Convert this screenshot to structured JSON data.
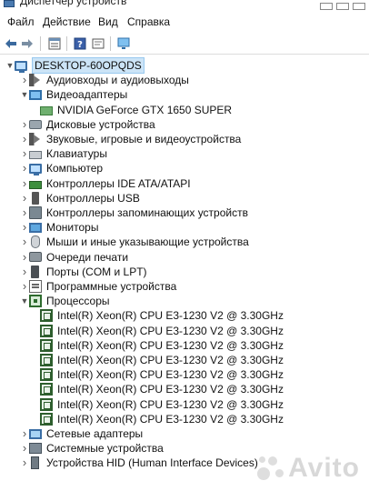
{
  "window": {
    "title": "Диспетчер устройств"
  },
  "menu": [
    "Файл",
    "Действие",
    "Вид",
    "Справка"
  ],
  "toolbar": [
    {
      "icon": "back-arrow-icon"
    },
    {
      "icon": "forward-arrow-icon"
    },
    {
      "icon": "properties-icon"
    },
    {
      "icon": "help-icon"
    },
    {
      "icon": "scan-hardware-icon"
    },
    {
      "icon": "monitor-view-icon"
    }
  ],
  "tree": {
    "root": "DESKTOP-60OPQDS",
    "items": [
      {
        "label": "Аудиовходы и аудиовыходы",
        "icon": "speaker-icon",
        "expanded": false
      },
      {
        "label": "Видеоадаптеры",
        "icon": "display-adapter-icon",
        "expanded": true
      },
      {
        "label": "NVIDIA GeForce GTX 1650 SUPER",
        "icon": "gpu-icon",
        "child": true
      },
      {
        "label": "Дисковые устройства",
        "icon": "disk-icon",
        "expanded": false
      },
      {
        "label": "Звуковые, игровые и видеоустройства",
        "icon": "sound-device-icon",
        "expanded": false
      },
      {
        "label": "Клавиатуры",
        "icon": "keyboard-icon",
        "expanded": false
      },
      {
        "label": "Компьютер",
        "icon": "computer-icon",
        "expanded": false
      },
      {
        "label": "Контроллеры IDE ATA/ATAPI",
        "icon": "ide-controller-icon",
        "expanded": false
      },
      {
        "label": "Контроллеры USB",
        "icon": "usb-icon",
        "expanded": false
      },
      {
        "label": "Контроллеры запоминающих устройств",
        "icon": "storage-controller-icon",
        "expanded": false
      },
      {
        "label": "Мониторы",
        "icon": "monitor-icon",
        "expanded": false
      },
      {
        "label": "Мыши и иные указывающие устройства",
        "icon": "mouse-icon",
        "expanded": false
      },
      {
        "label": "Очереди печати",
        "icon": "printer-icon",
        "expanded": false
      },
      {
        "label": "Порты (COM и LPT)",
        "icon": "port-icon",
        "expanded": false
      },
      {
        "label": "Программные устройства",
        "icon": "software-device-icon",
        "expanded": false
      },
      {
        "label": "Процессоры",
        "icon": "processor-icon",
        "expanded": true
      },
      {
        "label": "Intel(R) Xeon(R) CPU E3-1230 V2 @ 3.30GHz",
        "icon": "cpu-icon",
        "child": true
      },
      {
        "label": "Intel(R) Xeon(R) CPU E3-1230 V2 @ 3.30GHz",
        "icon": "cpu-icon",
        "child": true
      },
      {
        "label": "Intel(R) Xeon(R) CPU E3-1230 V2 @ 3.30GHz",
        "icon": "cpu-icon",
        "child": true
      },
      {
        "label": "Intel(R) Xeon(R) CPU E3-1230 V2 @ 3.30GHz",
        "icon": "cpu-icon",
        "child": true
      },
      {
        "label": "Intel(R) Xeon(R) CPU E3-1230 V2 @ 3.30GHz",
        "icon": "cpu-icon",
        "child": true
      },
      {
        "label": "Intel(R) Xeon(R) CPU E3-1230 V2 @ 3.30GHz",
        "icon": "cpu-icon",
        "child": true
      },
      {
        "label": "Intel(R) Xeon(R) CPU E3-1230 V2 @ 3.30GHz",
        "icon": "cpu-icon",
        "child": true
      },
      {
        "label": "Intel(R) Xeon(R) CPU E3-1230 V2 @ 3.30GHz",
        "icon": "cpu-icon",
        "child": true
      },
      {
        "label": "Сетевые адаптеры",
        "icon": "network-adapter-icon",
        "expanded": false
      },
      {
        "label": "Системные устройства",
        "icon": "system-device-icon",
        "expanded": false
      },
      {
        "label": "Устройства HID (Human Interface Devices)",
        "icon": "hid-icon",
        "expanded": false
      }
    ]
  },
  "watermark": "Avito"
}
